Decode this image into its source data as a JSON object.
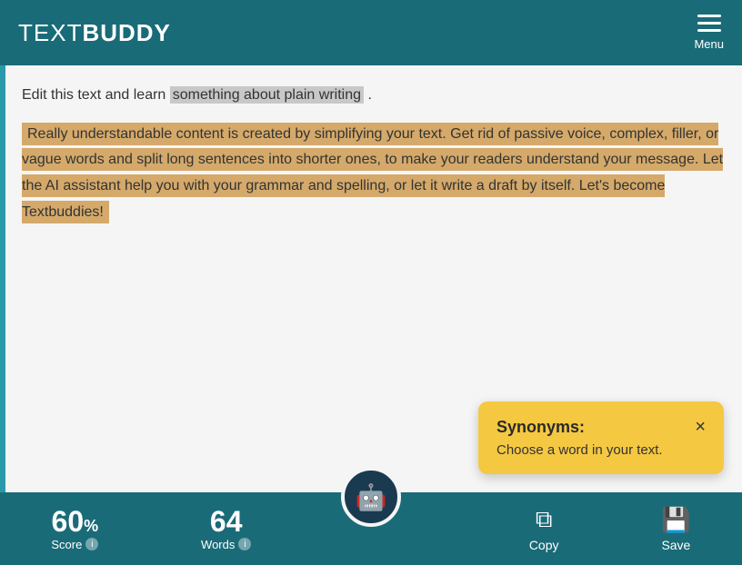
{
  "header": {
    "logo_text": "TEXT",
    "logo_buddy": "BUDDY",
    "menu_label": "Menu"
  },
  "editor": {
    "line1_before": "Edit this text and learn ",
    "line1_highlight": "something about plain writing",
    "line1_after": " .",
    "paragraph": "Really understandable content is created by simplifying your text. Get rid of passive voice, complex, filler, or vague words and split long sentences into shorter ones, to make your readers understand your message. Let the AI assistant help you with your grammar and spelling, or let it write a draft by itself. Let's become Textbuddies!"
  },
  "synonyms": {
    "title": "Synonyms:",
    "body": "Choose a word in your text.",
    "close_label": "×"
  },
  "bottom_bar": {
    "score_value": "60",
    "score_percent": "%",
    "score_label": "Score",
    "words_value": "64",
    "words_label": "Words",
    "copy_label": "Copy",
    "save_label": "Save"
  }
}
